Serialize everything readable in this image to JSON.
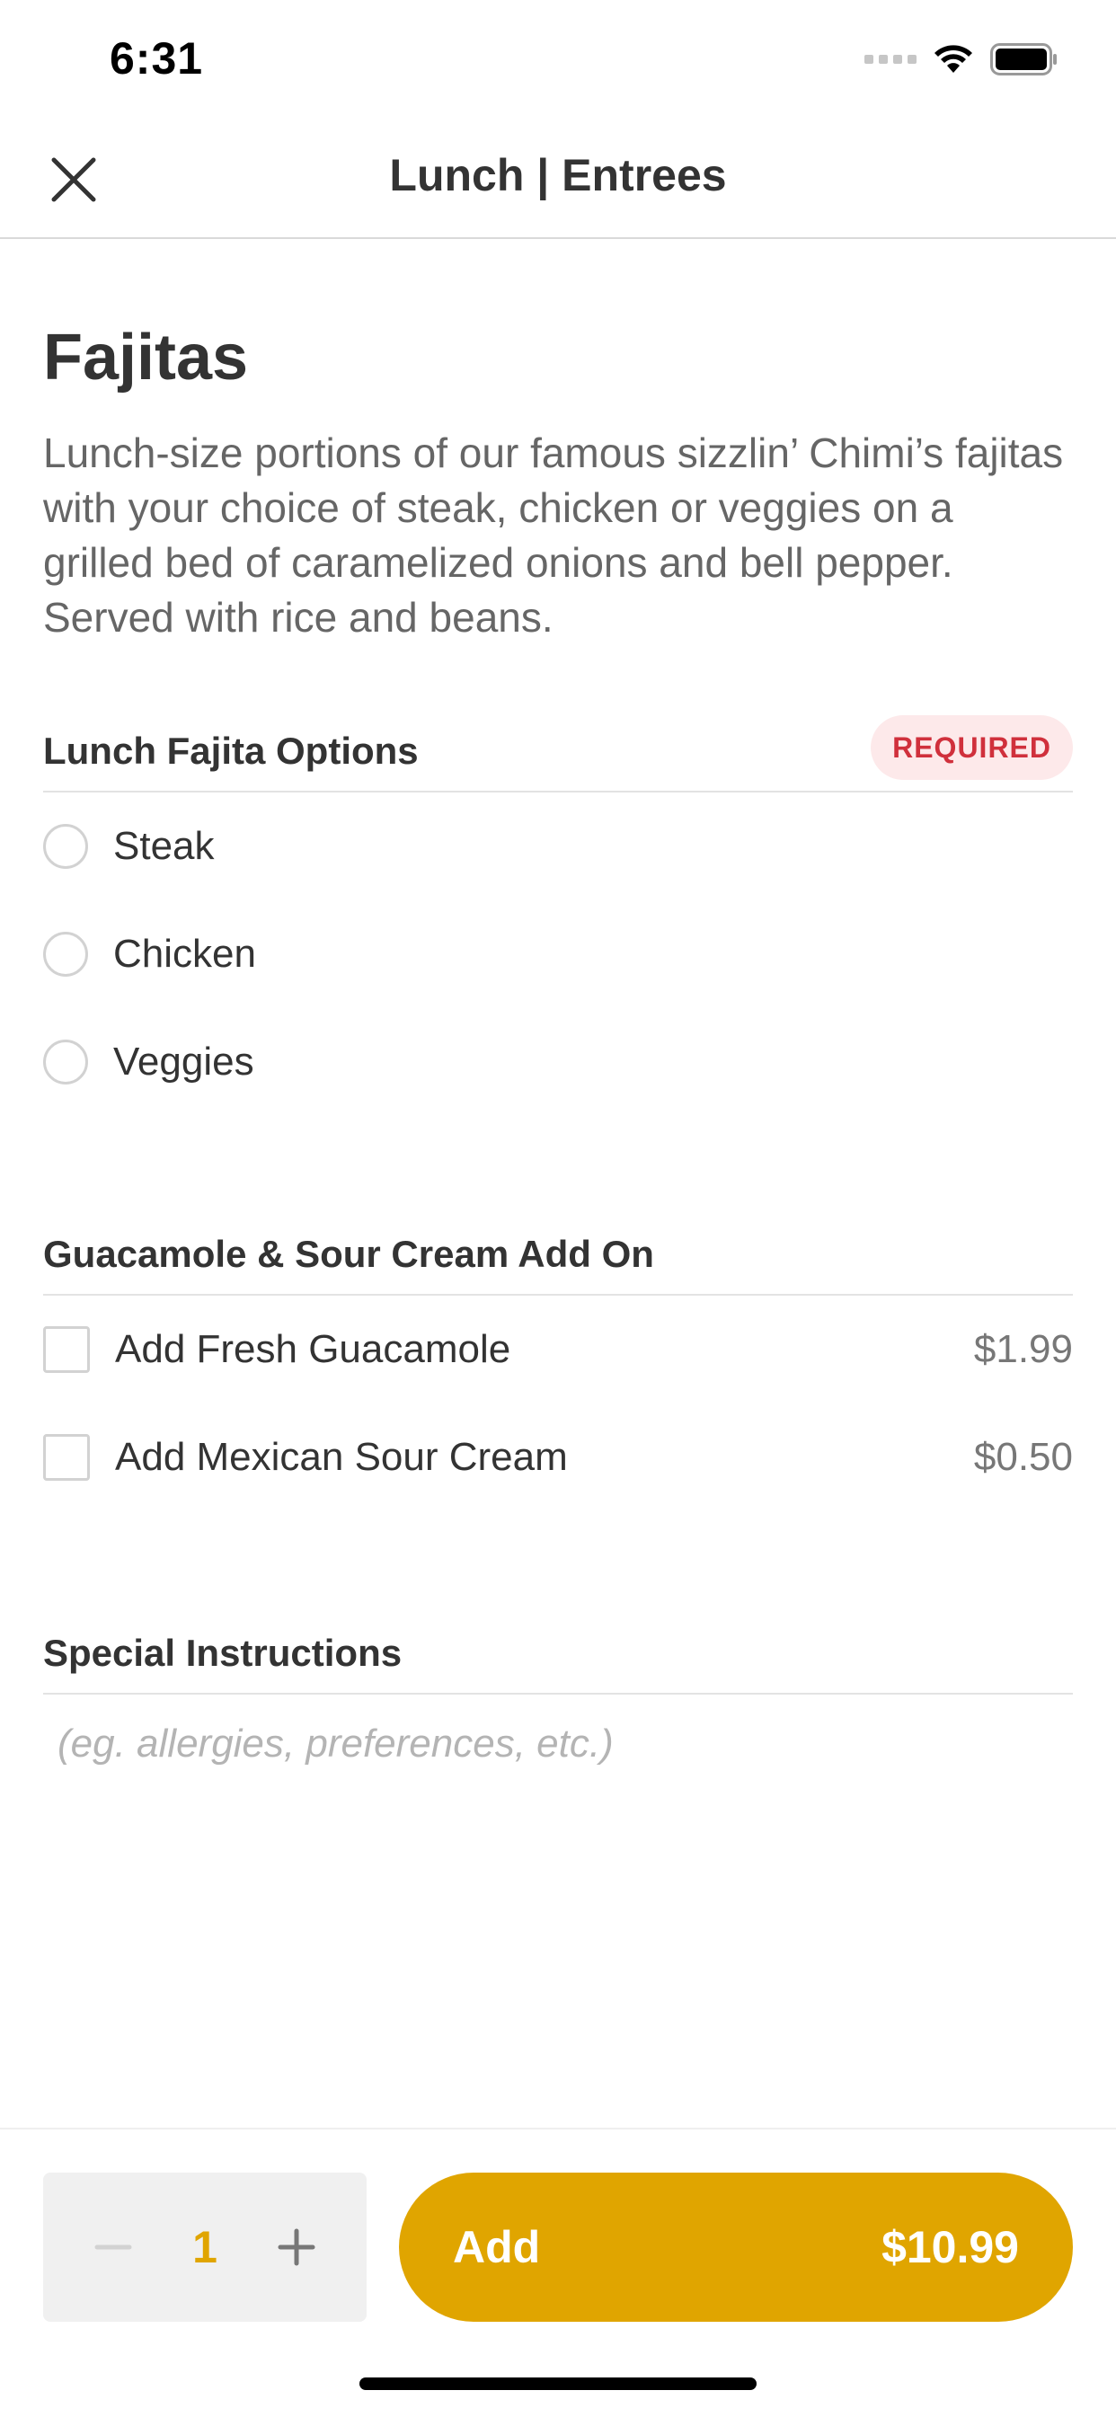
{
  "status_bar": {
    "time": "6:31",
    "icons": [
      "cellular-signal-icon",
      "wifi-icon",
      "battery-icon"
    ]
  },
  "header": {
    "title": "Lunch | Entrees",
    "close_icon": "close-icon"
  },
  "item": {
    "name": "Fajitas",
    "description": "Lunch-size portions of our famous sizzlin’ Chimi’s fajitas with your choice of steak, chicken or veggies on a grilled bed of caramelized onions and bell pepper. Served with rice and beans."
  },
  "sections": {
    "fajita_options": {
      "title": "Lunch Fajita Options",
      "badge": "REQUIRED",
      "options": [
        {
          "label": "Steak"
        },
        {
          "label": "Chicken"
        },
        {
          "label": "Veggies"
        }
      ]
    },
    "addons": {
      "title": "Guacamole & Sour Cream Add On",
      "options": [
        {
          "label": "Add Fresh Guacamole",
          "price": "$1.99"
        },
        {
          "label": "Add Mexican Sour Cream",
          "price": "$0.50"
        }
      ]
    },
    "instructions": {
      "title": "Special Instructions",
      "placeholder": "(eg. allergies, preferences, etc.)"
    }
  },
  "cart": {
    "quantity": "1",
    "add_label": "Add",
    "add_price": "$10.99"
  },
  "colors": {
    "accent": "#e0a500",
    "required_text": "#d0303c",
    "required_bg": "#fde9ea"
  }
}
